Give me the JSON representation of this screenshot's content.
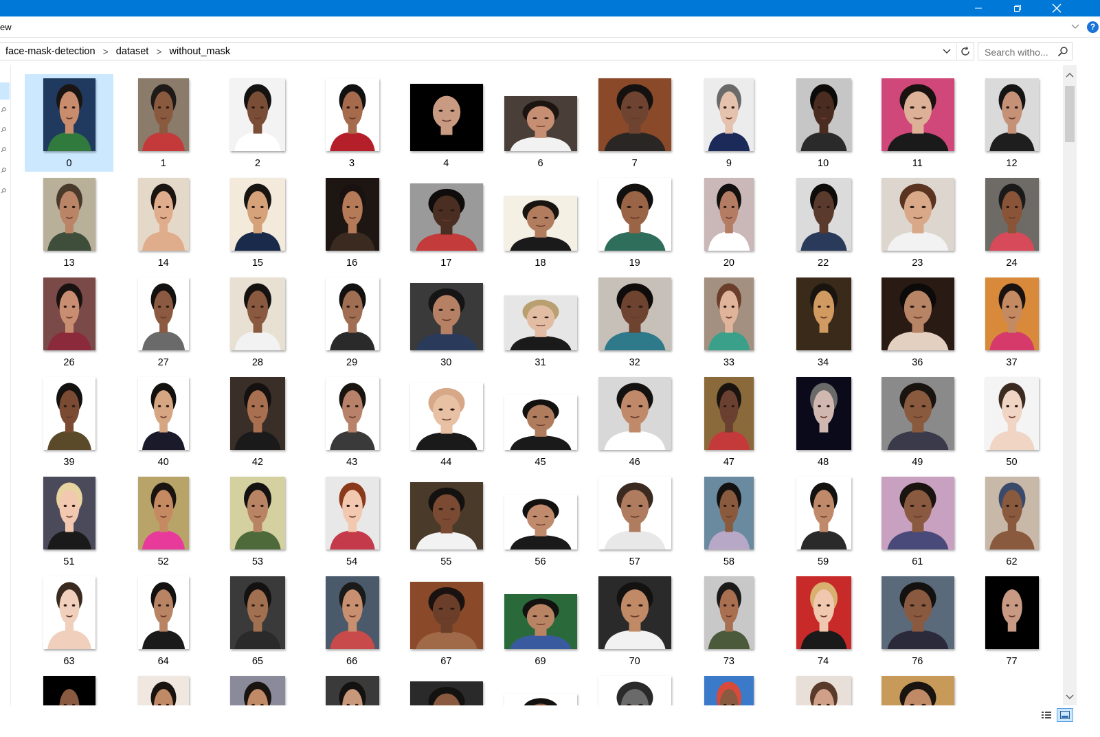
{
  "window": {
    "title": "",
    "controls": [
      {
        "name": "minimize-icon"
      },
      {
        "name": "restore-icon"
      },
      {
        "name": "close-icon"
      }
    ]
  },
  "ribbon": {
    "tab_fragment": "ew",
    "help_label": "?"
  },
  "address": {
    "crumbs": [
      "face-mask-detection",
      "dataset",
      "without_mask"
    ],
    "separator": ">"
  },
  "search": {
    "placeholder": "Search witho..."
  },
  "colors": {
    "titlebar": "#0078d7",
    "selection": "#cce8ff",
    "accent": "#0078d7"
  },
  "files": [
    {
      "name": "0",
      "bg": "#1f3a5e",
      "skin": "#c98d6e",
      "hair": "#1a1412",
      "cloth": "#2f7a3c",
      "selected": true
    },
    {
      "name": "1",
      "bg": "#8a7b6a",
      "skin": "#8a5a3e",
      "hair": "#1e1a18",
      "cloth": "#c43a3a"
    },
    {
      "name": "2",
      "bg": "#f3f3f3",
      "skin": "#7a4e36",
      "hair": "#151312",
      "cloth": "#ffffff"
    },
    {
      "name": "3",
      "bg": "#ffffff",
      "skin": "#a56b4c",
      "hair": "#111111",
      "cloth": "#b51f2a"
    },
    {
      "name": "4",
      "bg": "#000000",
      "skin": "#c99a82",
      "hair": "#000000",
      "cloth": "#000000"
    },
    {
      "name": "6",
      "bg": "#4a3f38",
      "skin": "#c68e72",
      "hair": "#1b1411",
      "cloth": "#f2f2f2"
    },
    {
      "name": "7",
      "bg": "#8a4a2a",
      "skin": "#6e4330",
      "hair": "#141110",
      "cloth": "#2a2624"
    },
    {
      "name": "9",
      "bg": "#ececec",
      "skin": "#e4c2ad",
      "hair": "#6a6a6a",
      "cloth": "#1c2a5a"
    },
    {
      "name": "10",
      "bg": "#c6c6c6",
      "skin": "#4a2c20",
      "hair": "#0d0b0a",
      "cloth": "#2a2a2a"
    },
    {
      "name": "11",
      "bg": "#d0487a",
      "skin": "#ddb098",
      "hair": "#1a1210",
      "cloth": "#1a1a1a"
    },
    {
      "name": "12",
      "bg": "#dadada",
      "skin": "#c59278",
      "hair": "#141414",
      "cloth": "#1e1e1e"
    },
    {
      "name": "13",
      "bg": "#b9b09a",
      "skin": "#b98566",
      "hair": "#4a3a2c",
      "cloth": "#3e4e3a"
    },
    {
      "name": "14",
      "bg": "#e4d8c9",
      "skin": "#e0ad8c",
      "hair": "#1b1512",
      "cloth": "#e0ad8c"
    },
    {
      "name": "15",
      "bg": "#f4eadc",
      "skin": "#d6a27a",
      "hair": "#181412",
      "cloth": "#1a2a4a"
    },
    {
      "name": "16",
      "bg": "#1e1612",
      "skin": "#b57a58",
      "hair": "#1a1210",
      "cloth": "#3a2a20"
    },
    {
      "name": "17",
      "bg": "#9a9a9a",
      "skin": "#4a2e22",
      "hair": "#0f0c0b",
      "cloth": "#c33b3b"
    },
    {
      "name": "18",
      "bg": "#f4f0e4",
      "skin": "#b27c5e",
      "hair": "#1a1410",
      "cloth": "#1a1a1a"
    },
    {
      "name": "19",
      "bg": "#ffffff",
      "skin": "#9a6446",
      "hair": "#121110",
      "cloth": "#2e6e5a"
    },
    {
      "name": "20",
      "bg": "#cab7b8",
      "skin": "#b57c64",
      "hair": "#121110",
      "cloth": "#ffffff"
    },
    {
      "name": "22",
      "bg": "#dbdbdb",
      "skin": "#5a3a2c",
      "hair": "#0e0c0b",
      "cloth": "#2a3a5a"
    },
    {
      "name": "23",
      "bg": "#ddd6ce",
      "skin": "#d8a888",
      "hair": "#5a3420",
      "cloth": "#f2f2f2"
    },
    {
      "name": "24",
      "bg": "#6e6a66",
      "skin": "#8a5438",
      "hair": "#1a1a1a",
      "cloth": "#d64a5a"
    },
    {
      "name": "26",
      "bg": "#7a4a48",
      "skin": "#c98e72",
      "hair": "#1a1210",
      "cloth": "#8a2a3a"
    },
    {
      "name": "27",
      "bg": "#ffffff",
      "skin": "#8c5a40",
      "hair": "#141210",
      "cloth": "#6a6a6a"
    },
    {
      "name": "28",
      "bg": "#e8e0d2",
      "skin": "#8a5a40",
      "hair": "#141110",
      "cloth": "#f2f2f2"
    },
    {
      "name": "29",
      "bg": "#ffffff",
      "skin": "#a06e52",
      "hair": "#121110",
      "cloth": "#2a2a2a"
    },
    {
      "name": "30",
      "bg": "#3a3a3a",
      "skin": "#b58064",
      "hair": "#151515",
      "cloth": "#2a3a5a"
    },
    {
      "name": "31",
      "bg": "#e6e6e6",
      "skin": "#e3bca4",
      "hair": "#b8a070",
      "cloth": "#1a1a1a"
    },
    {
      "name": "32",
      "bg": "#c6c0b8",
      "skin": "#6e4430",
      "hair": "#0f0c0b",
      "cloth": "#2e7a8a"
    },
    {
      "name": "33",
      "bg": "#a49080",
      "skin": "#e0b49a",
      "hair": "#6a3e2a",
      "cloth": "#3aa08a"
    },
    {
      "name": "34",
      "bg": "#3a2a1a",
      "skin": "#d09a60",
      "hair": "#1a1410",
      "cloth": "#3a2a1a"
    },
    {
      "name": "36",
      "bg": "#2a1a14",
      "skin": "#b88466",
      "hair": "#0d0b0a",
      "cloth": "#e4d0c0"
    },
    {
      "name": "37",
      "bg": "#d88a3a",
      "skin": "#c48a62",
      "hair": "#1a1210",
      "cloth": "#d63a6a"
    },
    {
      "name": "39",
      "bg": "#ffffff",
      "skin": "#7a4a32",
      "hair": "#141210",
      "cloth": "#5a4a2a"
    },
    {
      "name": "40",
      "bg": "#ffffff",
      "skin": "#d6a682",
      "hair": "#121110",
      "cloth": "#1a1a2a"
    },
    {
      "name": "42",
      "bg": "#3a2e28",
      "skin": "#a87050",
      "hair": "#141110",
      "cloth": "#1a1a1a"
    },
    {
      "name": "43",
      "bg": "#ffffff",
      "skin": "#b8826a",
      "hair": "#1a1410",
      "cloth": "#3a3a3a"
    },
    {
      "name": "44",
      "bg": "#ffffff",
      "skin": "#e8c0a4",
      "hair": "#d6a888",
      "cloth": "#1a1a1a"
    },
    {
      "name": "45",
      "bg": "#ffffff",
      "skin": "#b07c5e",
      "hair": "#121110",
      "cloth": "#1a1a1a"
    },
    {
      "name": "46",
      "bg": "#d8d8d8",
      "skin": "#c08a6a",
      "hair": "#141210",
      "cloth": "#ffffff"
    },
    {
      "name": "47",
      "bg": "#8a6a3a",
      "skin": "#6a4030",
      "hair": "#1a1410",
      "cloth": "#c43a3a"
    },
    {
      "name": "48",
      "bg": "#0a0a1a",
      "skin": "#d0b8b0",
      "hair": "#6a6a6a",
      "cloth": "#0a0a1a"
    },
    {
      "name": "49",
      "bg": "#8a8a8a",
      "skin": "#8a5a3e",
      "hair": "#1a1410",
      "cloth": "#3a3a4a"
    },
    {
      "name": "50",
      "bg": "#f4f4f4",
      "skin": "#f0d4c4",
      "hair": "#3a2a20",
      "cloth": "#f0d4c4"
    },
    {
      "name": "51",
      "bg": "#4a4a5a",
      "skin": "#f2c8b0",
      "hair": "#e8d4a0",
      "cloth": "#1a1a1a"
    },
    {
      "name": "52",
      "bg": "#b8a468",
      "skin": "#c68a62",
      "hair": "#1a1410",
      "cloth": "#e83a9a"
    },
    {
      "name": "53",
      "bg": "#d4d0a0",
      "skin": "#b88464",
      "hair": "#141210",
      "cloth": "#4e6a3a"
    },
    {
      "name": "54",
      "bg": "#e8e8e8",
      "skin": "#f2c8b0",
      "hair": "#8a3a1a",
      "cloth": "#c43a4a"
    },
    {
      "name": "55",
      "bg": "#4a3a2a",
      "skin": "#7a4a32",
      "hair": "#141210",
      "cloth": "#f2f2f2"
    },
    {
      "name": "56",
      "bg": "#ffffff",
      "skin": "#c08a6c",
      "hair": "#121110",
      "cloth": "#1a1a1a"
    },
    {
      "name": "57",
      "bg": "#ffffff",
      "skin": "#b07c60",
      "hair": "#3a2a20",
      "cloth": "#e8e8e8"
    },
    {
      "name": "58",
      "bg": "#6a8aa0",
      "skin": "#8a5a3e",
      "hair": "#141210",
      "cloth": "#b8a8c8"
    },
    {
      "name": "59",
      "bg": "#ffffff",
      "skin": "#c08a6a",
      "hair": "#141210",
      "cloth": "#2a2a2a"
    },
    {
      "name": "61",
      "bg": "#c8a0c0",
      "skin": "#8a5a40",
      "hair": "#1a1410",
      "cloth": "#4a4a7a"
    },
    {
      "name": "62",
      "bg": "#c8b8a8",
      "skin": "#8a5a3e",
      "hair": "#3a4a6a",
      "cloth": "#8a5a3e"
    },
    {
      "name": "63",
      "bg": "#ffffff",
      "skin": "#f0d0bc",
      "hair": "#3a2a20",
      "cloth": "#f0d0bc"
    },
    {
      "name": "64",
      "bg": "#ffffff",
      "skin": "#b88464",
      "hair": "#141210",
      "cloth": "#1a1a1a"
    },
    {
      "name": "65",
      "bg": "#3a3a3a",
      "skin": "#a07050",
      "hair": "#141210",
      "cloth": "#2a2a2a"
    },
    {
      "name": "66",
      "bg": "#4a5a6a",
      "skin": "#c89070",
      "hair": "#1a1a1a",
      "cloth": "#c84a4a"
    },
    {
      "name": "67",
      "bg": "#8a4a2a",
      "skin": "#6a3e28",
      "hair": "#1a1210",
      "cloth": "#a06a48"
    },
    {
      "name": "69",
      "bg": "#2a6a3a",
      "skin": "#b88464",
      "hair": "#141210",
      "cloth": "#3a5aa0"
    },
    {
      "name": "70",
      "bg": "#2a2a2a",
      "skin": "#c08a66",
      "hair": "#141210",
      "cloth": "#f2f2f2"
    },
    {
      "name": "73",
      "bg": "#c8c8c8",
      "skin": "#a87050",
      "hair": "#1a1a1a",
      "cloth": "#4a5a3a"
    },
    {
      "name": "74",
      "bg": "#c82a2a",
      "skin": "#f0c8b0",
      "hair": "#d8b070",
      "cloth": "#1a1a1a"
    },
    {
      "name": "76",
      "bg": "#5a6a7a",
      "skin": "#8a5a40",
      "hair": "#141210",
      "cloth": "#2a2a3a"
    },
    {
      "name": "77",
      "bg": "#000000",
      "skin": "#c89a84",
      "hair": "#000000",
      "cloth": "#000000"
    },
    {
      "name": "",
      "bg": "#000000",
      "skin": "#8a5a40",
      "hair": "#000000",
      "cloth": "#000000"
    },
    {
      "name": "",
      "bg": "#f0e8e0",
      "skin": "#c08a66",
      "hair": "#1a1410",
      "cloth": "#c08a66"
    },
    {
      "name": "",
      "bg": "#8a8a9a",
      "skin": "#c08a66",
      "hair": "#1a1410",
      "cloth": "#c08a66"
    },
    {
      "name": "",
      "bg": "#3a3a3a",
      "skin": "#c8987a",
      "hair": "#141210",
      "cloth": "#c8987a"
    },
    {
      "name": "",
      "bg": "#2a2a2a",
      "skin": "#8a5a40",
      "hair": "#141210",
      "cloth": "#8a5a40"
    },
    {
      "name": "",
      "bg": "#ffffff",
      "skin": "#8a5a40",
      "hair": "#141210",
      "cloth": "#8a5a40"
    },
    {
      "name": "",
      "bg": "#ffffff",
      "skin": "#6a6a6a",
      "hair": "#2a2a2a",
      "cloth": "#6a6a6a"
    },
    {
      "name": "",
      "bg": "#3a7ac8",
      "skin": "#8a5a40",
      "hair": "#d84a3a",
      "cloth": "#8a5a40"
    },
    {
      "name": "",
      "bg": "#e8e0d8",
      "skin": "#d0a088",
      "hair": "#5a3a2a",
      "cloth": "#d0a088"
    },
    {
      "name": "",
      "bg": "#c89a5a",
      "skin": "#c08a66",
      "hair": "#1a1410",
      "cloth": "#c08a66"
    }
  ],
  "statusbar": {
    "views": [
      {
        "name": "details-view-icon",
        "active": false
      },
      {
        "name": "large-icons-view-icon",
        "active": true
      }
    ]
  }
}
